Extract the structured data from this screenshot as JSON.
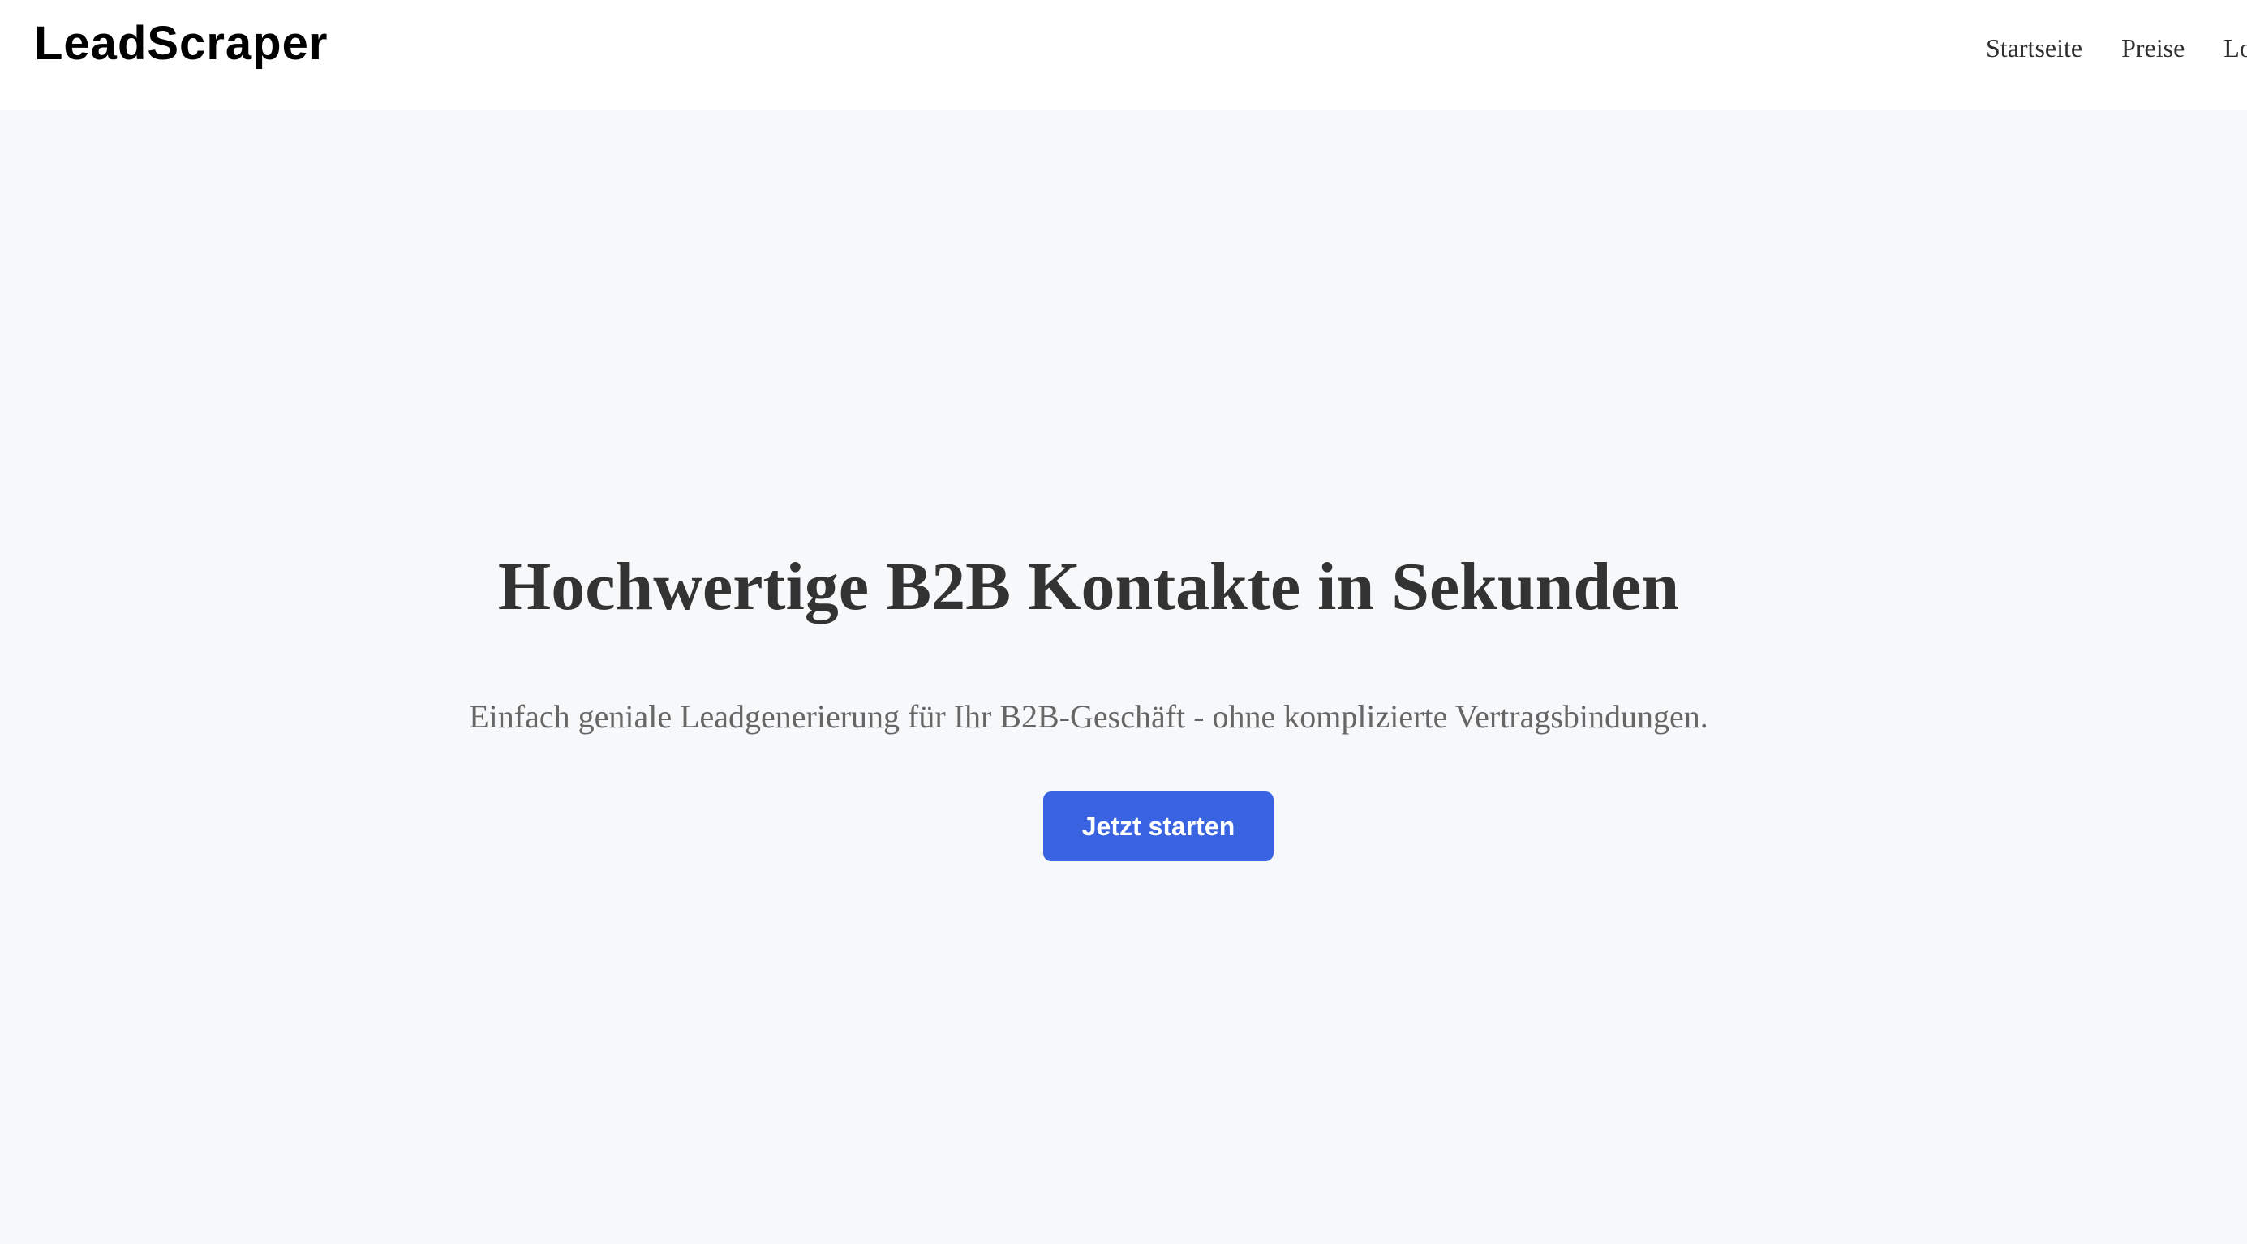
{
  "header": {
    "logo": "LeadScraper",
    "nav": [
      "Startseite",
      "Preise",
      "Lo"
    ]
  },
  "hero": {
    "title": "Hochwertige B2B Kontakte in Sekunden",
    "subtitle": "Einfach geniale Leadgenerierung für Ihr B2B-Geschäft - ohne komplizierte Vertragsbindungen.",
    "cta_label": "Jetzt starten"
  },
  "colors": {
    "background": "#f7f8fa",
    "header_background": "#ffffff",
    "primary_button": "#3a63e2",
    "title_text": "#333333",
    "subtitle_text": "#666666"
  }
}
